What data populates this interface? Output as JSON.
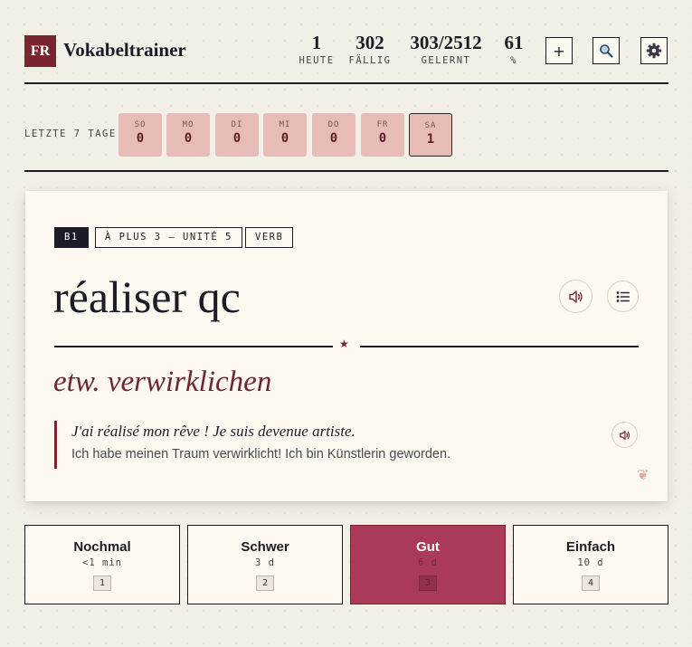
{
  "header": {
    "logo_text": "FR",
    "app_title": "Vokabeltrainer",
    "stats": [
      {
        "value": "1",
        "label": "HEUTE"
      },
      {
        "value": "302",
        "label": "FÄLLIG"
      },
      {
        "value": "303/2512",
        "label": "GELERNT"
      },
      {
        "value": "61",
        "label": "%"
      }
    ],
    "buttons": {
      "add": "+",
      "search": "search-icon",
      "settings": "gear-icon"
    }
  },
  "last_days": {
    "label": "LETZTE 7 TAGE",
    "days": [
      {
        "name": "SO",
        "count": "0"
      },
      {
        "name": "MO",
        "count": "0"
      },
      {
        "name": "DI",
        "count": "0"
      },
      {
        "name": "MI",
        "count": "0"
      },
      {
        "name": "DO",
        "count": "0"
      },
      {
        "name": "FR",
        "count": "0"
      },
      {
        "name": "SA",
        "count": "1"
      }
    ]
  },
  "card": {
    "tags": [
      "B1",
      "À PLUS 3 – UNITÉ 5",
      "VERB"
    ],
    "word": "réaliser qc",
    "translation": "etw. verwirklichen",
    "example_fr": "J'ai réalisé mon rêve ! Je suis devenue artiste.",
    "example_de": "Ich habe meinen Traum verwirklicht! Ich bin Künstlerin geworden.",
    "icons": {
      "audio": "speaker-icon",
      "list": "list-icon",
      "favorite": "heart-icon"
    }
  },
  "answers": [
    {
      "label": "Nochmal",
      "interval": "<1 min",
      "key": "1"
    },
    {
      "label": "Schwer",
      "interval": "3 d",
      "key": "2"
    },
    {
      "label": "Gut",
      "interval": "6 d",
      "key": "3"
    },
    {
      "label": "Einfach",
      "interval": "10 d",
      "key": "4"
    }
  ],
  "colors": {
    "accent": "#7a2430",
    "active_answer": "#aa3a59",
    "day_tile": "#e8bcb6",
    "background": "#f2efe6"
  }
}
